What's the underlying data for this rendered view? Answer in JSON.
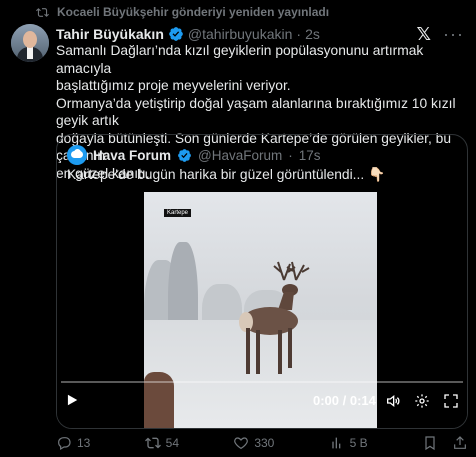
{
  "repost_notice": "Kocaeli Büyükşehir gönderiyi yeniden yayınladı",
  "tweet": {
    "name": "Tahir Büyükakın",
    "handle": "@tahirbuyukakin",
    "dot": "·",
    "time": "2s",
    "text_line1": "Samanlı Dağları’nda kızıl geyiklerin popülasyonunu artırmak amacıyla",
    "text_line2": "başlattığımız proje meyvelerini veriyor.",
    "text_line3": "Ormanya’da yetiştirip doğal yaşam alanlarına bıraktığımız 10 kızıl geyik artık",
    "text_line4": "doğayla bütünleşti. Son günlerde Kartepe’de görülen geyikler, bu çabanın",
    "text_line5": "en güzel kanıtı."
  },
  "quote": {
    "name": "Hava Forum",
    "handle": "@HavaForum",
    "dot": "·",
    "time": "17s",
    "text": "Kartepe'de bugün harika bir güzel görüntülendi... 👇🏻",
    "video_label": "Kartepe",
    "video_time": "0:00 / 0:14"
  },
  "actions": {
    "replies": "13",
    "reposts": "54",
    "likes": "330",
    "views": "5 B"
  },
  "icons": {
    "repost": "repost-icon",
    "verified": "verified-badge-icon",
    "x": "x-logo-icon",
    "more": "more-icon",
    "play": "play-icon",
    "volume": "volume-icon",
    "settings": "settings-gear-icon",
    "fullscreen": "fullscreen-icon",
    "reply": "reply-icon",
    "like": "heart-icon",
    "views": "views-bar-icon",
    "bookmark": "bookmark-icon",
    "share": "share-icon"
  },
  "colors": {
    "accent": "#1d9bf0",
    "muted": "#71767b",
    "text": "#e7e9ea",
    "background": "#000000"
  }
}
